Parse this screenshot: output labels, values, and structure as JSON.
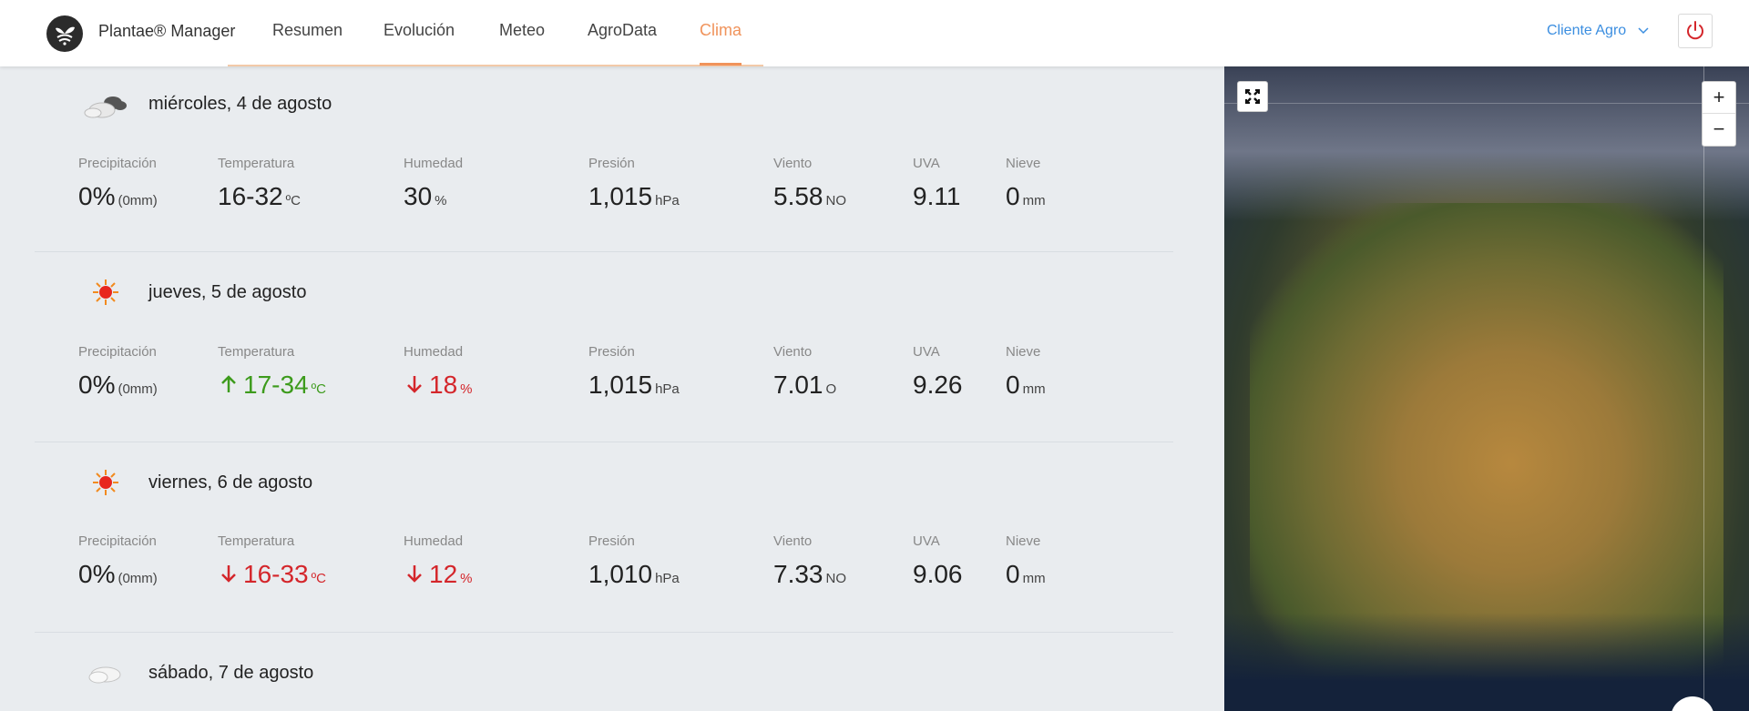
{
  "header": {
    "brand": "Plantae® Manager",
    "nav": [
      "Resumen",
      "Evolución",
      "Meteo",
      "AgroData",
      "Clima"
    ],
    "active": "Clima",
    "client": "Cliente Agro"
  },
  "labels": {
    "precip": "Precipitación",
    "temp": "Temperatura",
    "hum": "Humedad",
    "pres": "Presión",
    "wind": "Viento",
    "uva": "UVA",
    "snow": "Nieve"
  },
  "days": [
    {
      "title": "miércoles, 4 de agosto",
      "icon": "cloudy-icon",
      "precip": "0%",
      "precip_mm": "(0mm)",
      "temp": "16-32",
      "temp_unit": "ºC",
      "hum": "30",
      "hum_unit": "%",
      "pres": "1,015",
      "pres_unit": "hPa",
      "wind": "5.58",
      "wind_dir": "NO",
      "uva": "9.11",
      "snow": "0",
      "snow_unit": "mm"
    },
    {
      "title": "jueves, 5 de agosto",
      "icon": "sun-icon",
      "precip": "0%",
      "precip_mm": "(0mm)",
      "temp": "17-34",
      "temp_unit": "ºC",
      "hum": "18",
      "hum_unit": "%",
      "pres": "1,015",
      "pres_unit": "hPa",
      "wind": "7.01",
      "wind_dir": "O",
      "uva": "9.26",
      "snow": "0",
      "snow_unit": "mm"
    },
    {
      "title": "viernes, 6 de agosto",
      "icon": "sun-icon",
      "precip": "0%",
      "precip_mm": "(0mm)",
      "temp": "16-33",
      "temp_unit": "ºC",
      "hum": "12",
      "hum_unit": "%",
      "pres": "1,010",
      "pres_unit": "hPa",
      "wind": "7.33",
      "wind_dir": "NO",
      "uva": "9.06",
      "snow": "0",
      "snow_unit": "mm"
    },
    {
      "title": "sábado, 7 de agosto",
      "icon": "cloud-icon"
    }
  ],
  "map": {
    "zoom_in": "+",
    "zoom_out": "−"
  },
  "colors": {
    "accent": "#f0935b",
    "up": "#3d9b1c",
    "down": "#d4262b",
    "link": "#3b8ee0"
  }
}
